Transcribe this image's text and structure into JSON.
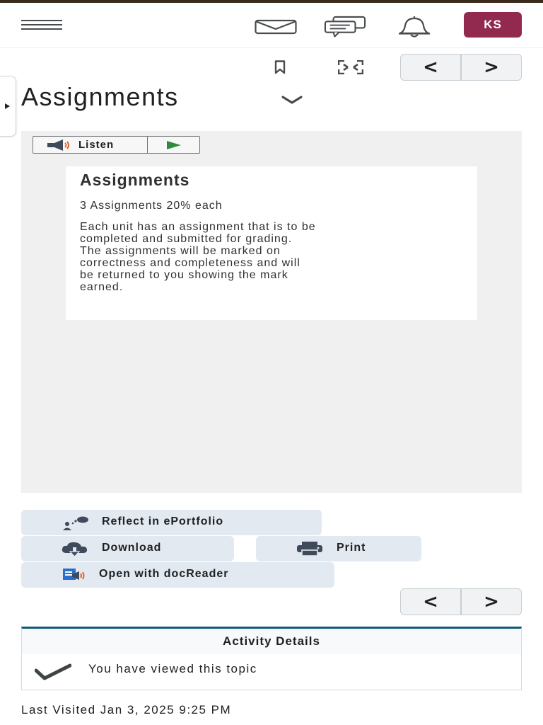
{
  "header": {
    "menu_icon": "hamburger-menu-icon",
    "icons": [
      "mail-icon",
      "chat-icon",
      "bell-icon"
    ],
    "avatar_initials": "KS",
    "avatar_color": "#92294f"
  },
  "toolbar": {
    "icons": [
      "bookmark-icon",
      "fullscreen-icon"
    ],
    "prev_label": "<",
    "next_label": ">"
  },
  "page": {
    "title": "Assignments"
  },
  "reader": {
    "listen_label": "Listen"
  },
  "document": {
    "heading": "Assignments",
    "subheading": "3 Assignments 20% each",
    "body_lines": [
      "Each unit has an assignment that is to be",
      "completed and submitted for grading.",
      "The assignments will be marked on",
      "correctness and completeness and will",
      "be returned to you showing the mark",
      "earned."
    ]
  },
  "actions": {
    "reflect_label": "Reflect in ePortfolio",
    "download_label": "Download",
    "print_label": "Print",
    "docreader_label": "Open with docReader"
  },
  "bottom_pager": {
    "prev_label": "<",
    "next_label": ">"
  },
  "activity": {
    "title": "Activity Details",
    "status_text": "You have viewed this topic",
    "accent_color": "#0a5c7a"
  },
  "last_visited": "Last Visited Jan 3, 2025 9:25 PM"
}
